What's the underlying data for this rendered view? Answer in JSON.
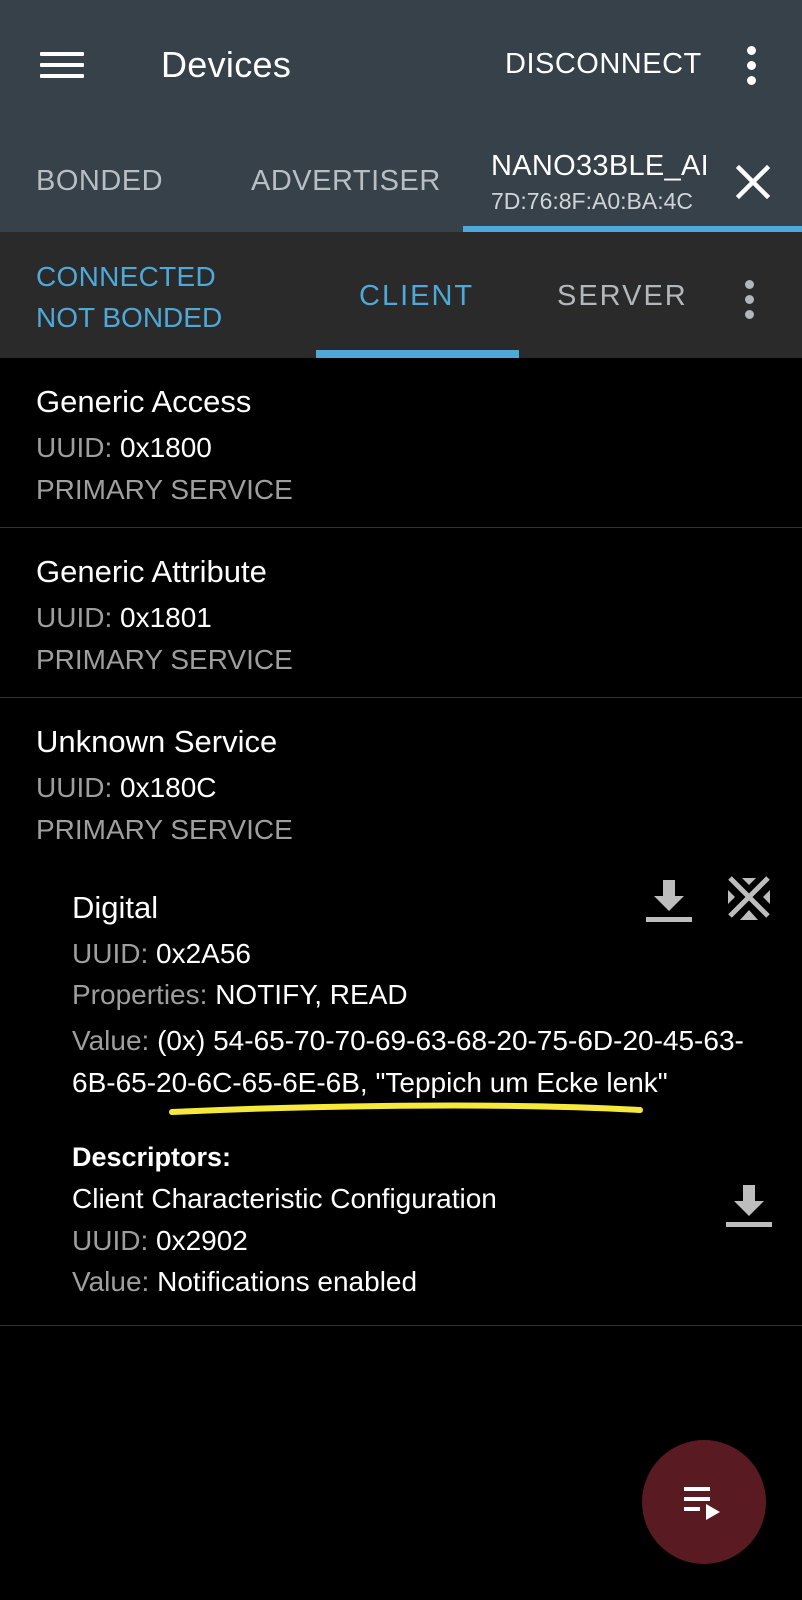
{
  "appbar": {
    "title": "Devices",
    "disconnect_label": "DISCONNECT",
    "tabs": [
      {
        "label": "BONDED"
      },
      {
        "label": "ADVERTISER"
      }
    ],
    "device_tab": {
      "name": "NANO33BLE_AI",
      "mac": "7D:76:8F:A0:BA:4C"
    }
  },
  "connection": {
    "status": "CONNECTED",
    "bond": "NOT BONDED",
    "tabs": [
      {
        "label": "CLIENT"
      },
      {
        "label": "SERVER"
      }
    ],
    "active_tab": "CLIENT"
  },
  "services": [
    {
      "name": "Generic Access",
      "uuid_label": "UUID:",
      "uuid": "0x1800",
      "type": "PRIMARY SERVICE"
    },
    {
      "name": "Generic Attribute",
      "uuid_label": "UUID:",
      "uuid": "0x1801",
      "type": "PRIMARY SERVICE"
    },
    {
      "name": "Unknown Service",
      "uuid_label": "UUID:",
      "uuid": "0x180C",
      "type": "PRIMARY SERVICE"
    }
  ],
  "characteristic": {
    "name": "Digital",
    "uuid_label": "UUID:",
    "uuid": "0x2A56",
    "properties_label": "Properties:",
    "properties": "NOTIFY, READ",
    "value_label": "Value:",
    "value": "(0x) 54-65-70-70-69-63-68-20-75-6D-20-45-63-6B-65-20-6C-65-6E-6B, \"Teppich um Ecke lenk\"",
    "descriptors_label": "Descriptors:",
    "descriptor": {
      "name": "Client Characteristic Configuration",
      "uuid_label": "UUID:",
      "uuid": "0x2902",
      "value_label": "Value:",
      "value": "Notifications enabled"
    }
  },
  "icons": {
    "menu": "hamburger-menu-icon",
    "overflow": "more-vert-icon",
    "close": "close-icon",
    "read": "download-icon",
    "notify": "notifications-off-icon",
    "fab": "playlist-play-icon"
  },
  "colors": {
    "appbar": "#37414a",
    "accent": "#4ea8d8",
    "fab": "#5a1a22",
    "highlight": "#f6e93a"
  }
}
